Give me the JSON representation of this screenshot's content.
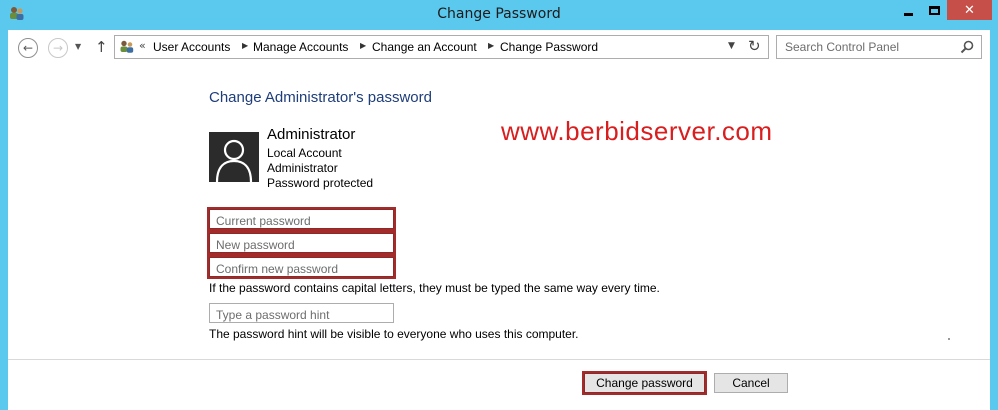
{
  "window": {
    "title": "Change Password",
    "close_glyph": "✕"
  },
  "nav": {
    "breadcrumb_prefix": "«",
    "breadcrumbs": [
      "User Accounts",
      "Manage Accounts",
      "Change an Account",
      "Change Password"
    ],
    "search_placeholder": "Search Control Panel"
  },
  "page": {
    "heading": "Change Administrator's password",
    "watermark": "www.berbidserver.com"
  },
  "account": {
    "name": "Administrator",
    "type": "Local Account",
    "role": "Administrator",
    "status": "Password protected"
  },
  "form": {
    "current_placeholder": "Current password",
    "new_placeholder": "New password",
    "confirm_placeholder": "Confirm new password",
    "caps_note": "If the password contains capital letters, they must be typed the same way every time.",
    "hint_placeholder": "Type a password hint",
    "hint_note": "The password hint will be visible to everyone who uses this computer."
  },
  "buttons": {
    "change": "Change password",
    "cancel": "Cancel"
  },
  "icons": {
    "app": "users-icon",
    "back": "back-arrow-icon",
    "forward": "forward-arrow-icon",
    "recent": "chevron-down-icon",
    "up": "up-arrow-icon",
    "address": "users-icon",
    "dropdown": "chevron-down-icon",
    "refresh": "refresh-icon",
    "search": "search-icon",
    "avatar": "user-avatar-icon"
  },
  "colors": {
    "titlebar": "#5bc8ee",
    "close": "#c74f49",
    "heading": "#1e3d7a",
    "highlight": "#a52a2a",
    "watermark": "#d81e1e"
  }
}
